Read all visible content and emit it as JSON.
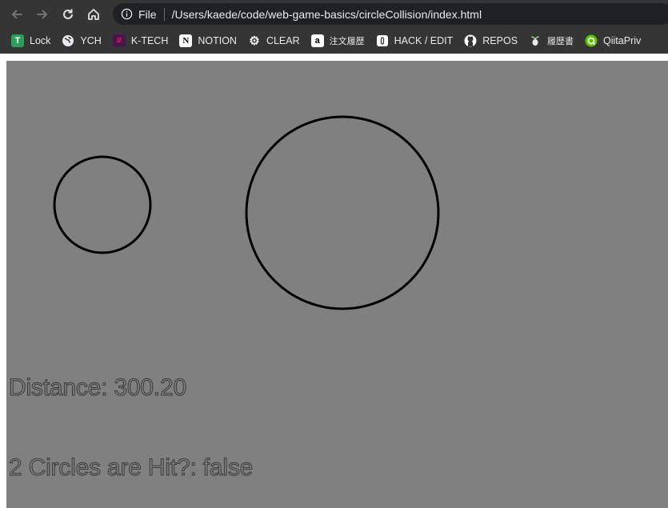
{
  "browser": {
    "omnibox": {
      "scheme": "File",
      "url": "/Users/kaede/code/web-game-basics/circleCollision/index.html"
    },
    "bookmarks": [
      {
        "label": "Lock",
        "icon": "lock-app-icon",
        "color": "#2e9e5b"
      },
      {
        "label": "YCH",
        "icon": "globe-icon",
        "color": "#e8eaed"
      },
      {
        "label": "K-TECH",
        "icon": "slack-icon",
        "color": "#4a154b"
      },
      {
        "label": "NOTION",
        "icon": "notion-icon",
        "color": "#ffffff"
      },
      {
        "label": "CLEAR",
        "icon": "gear-icon",
        "color": "#e8eaed"
      },
      {
        "label": "注文履歴",
        "icon": "amazon-icon",
        "color": "#ffffff"
      },
      {
        "label": "HACK / EDIT",
        "icon": "hackmd-icon",
        "color": "#ffffff"
      },
      {
        "label": "REPOS",
        "icon": "github-icon",
        "color": "#ffffff"
      },
      {
        "label": "履歴書",
        "icon": "sprout-icon",
        "color": "#9fd67a"
      },
      {
        "label": "QiitaPriv",
        "icon": "qiita-icon",
        "color": "#55c500"
      }
    ]
  },
  "canvas": {
    "background": "#808080",
    "distance_text": "Distance: 300.20",
    "hit_text": "2 Circles are Hit?: false"
  }
}
